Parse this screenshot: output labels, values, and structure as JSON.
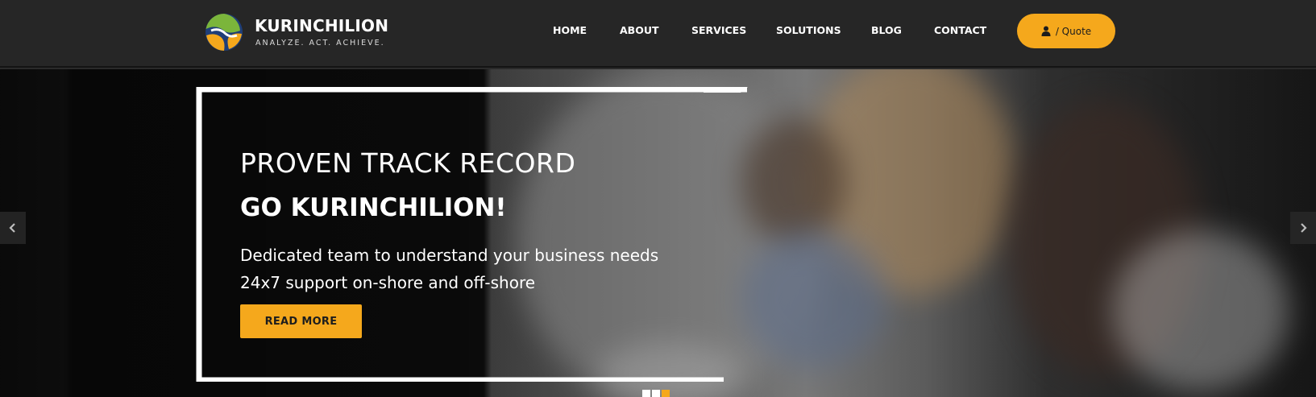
{
  "brand": {
    "name": "KURINCHILION",
    "tagline": "ANALYZE. ACT. ACHIEVE.",
    "colors": {
      "blue": "#1f3e78",
      "green": "#7bb53b",
      "orange": "#f5a81c"
    }
  },
  "nav": {
    "items": [
      {
        "label": "HOME"
      },
      {
        "label": "ABOUT"
      },
      {
        "label": "SERVICES"
      },
      {
        "label": "SOLUTIONS"
      },
      {
        "label": "BLOG"
      },
      {
        "label": "CONTACT"
      }
    ],
    "quote_label": "/ Quote",
    "quote_icon": "user-icon"
  },
  "hero": {
    "line1": "PROVEN TRACK RECORD",
    "line2": "GO KURINCHILION!",
    "desc_line1": "Dedicated team to understand your business needs",
    "desc_line2": "24x7 support on-shore and off-shore",
    "cta_label": "READ MORE",
    "prev_icon": "chevron-left-icon",
    "next_icon": "chevron-right-icon",
    "slide_count": 3,
    "active_slide": 3
  },
  "colors": {
    "accent": "#f5a81c",
    "header_bg": "#262626",
    "text": "#ffffff"
  }
}
